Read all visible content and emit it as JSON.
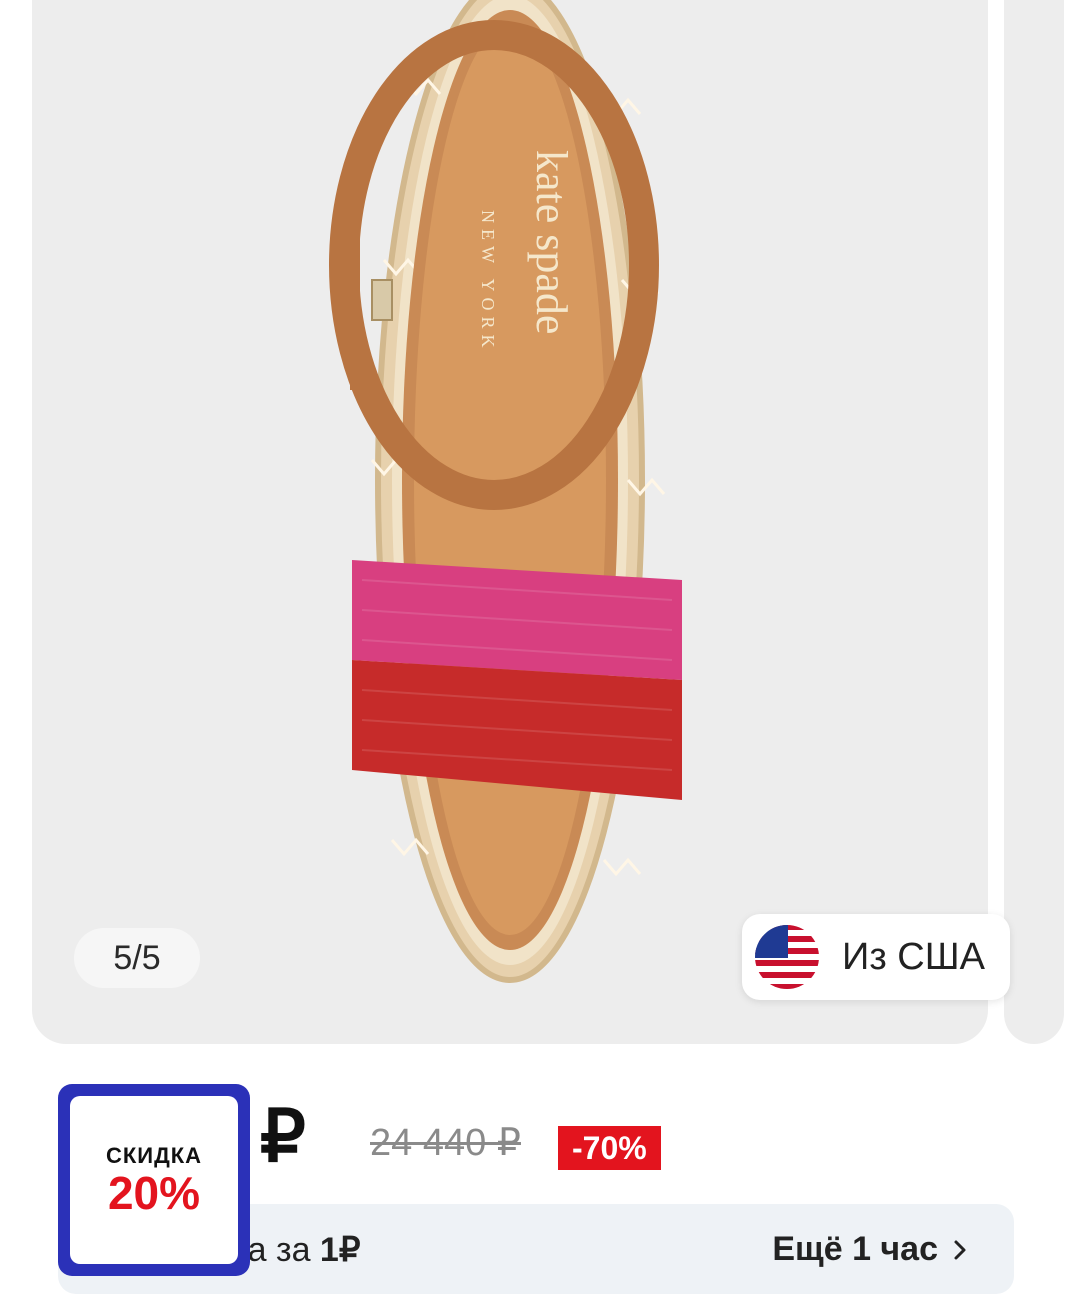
{
  "gallery": {
    "counter": "5/5",
    "origin": "Из США",
    "image_alt": "kate spade new york sandal",
    "brand_text": "kate spade",
    "brand_sub": "NEW YORK"
  },
  "price": {
    "current": "0 ₽",
    "old": "24 440 ₽",
    "discount": "-70%"
  },
  "promo": {
    "left_prefix": "ка за ",
    "left_value": "1₽",
    "right": "Ещё 1 час"
  },
  "sticker": {
    "top": "СКИДКА",
    "bottom": "20%"
  },
  "colors": {
    "accent_red": "#e3141e",
    "sticker_blue": "#2b31b8"
  },
  "icons": [
    "back-icon",
    "share-icon",
    "favorite-icon",
    "us-flag-icon",
    "chevron-right-icon"
  ]
}
